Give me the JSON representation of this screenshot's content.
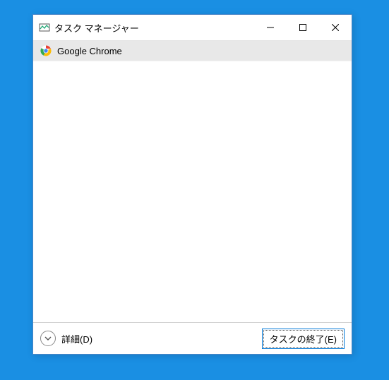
{
  "window": {
    "title": "タスク マネージャー"
  },
  "processes": [
    {
      "name": "Google Chrome"
    }
  ],
  "footer": {
    "details_label": "詳細(D)",
    "end_task_label": "タスクの終了(E)"
  }
}
